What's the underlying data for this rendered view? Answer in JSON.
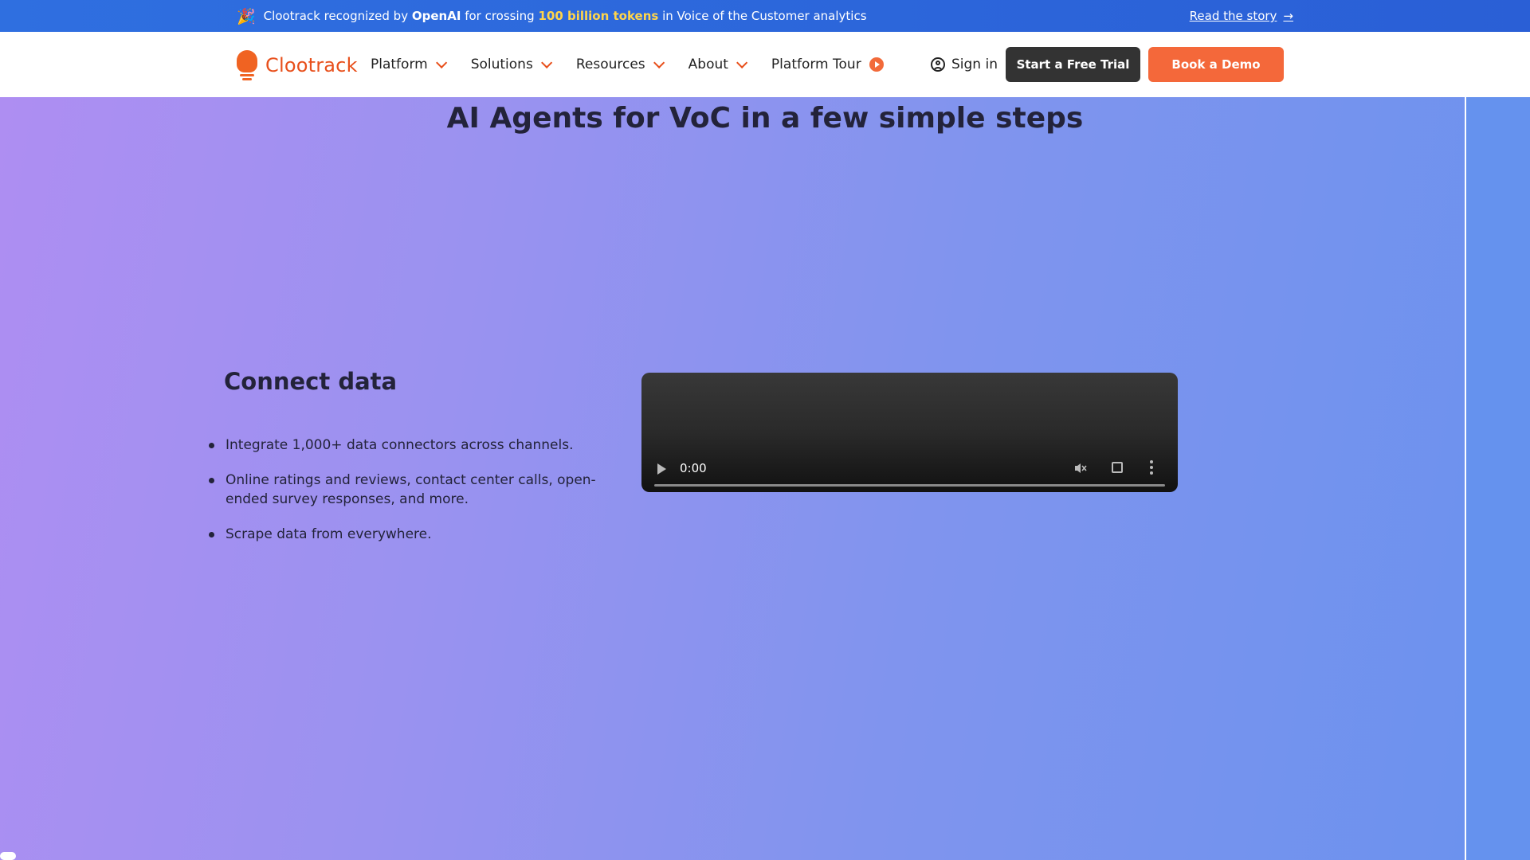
{
  "announcement": {
    "icon": "party-popper-icon",
    "prefix": "Clootrack recognized by",
    "brand": "OpenAI",
    "middle": "for crossing",
    "highlight": "100 billion tokens",
    "suffix": "in Voice of the Customer analytics",
    "link": "Read the story"
  },
  "nav": {
    "logo": "Clootrack",
    "menu": [
      {
        "label": "Platform"
      },
      {
        "label": "Solutions"
      },
      {
        "label": "Resources"
      },
      {
        "label": "About"
      },
      {
        "label": "Platform Tour"
      }
    ],
    "signin": "Sign in",
    "trial_button": "Start a Free Trial",
    "demo_button": "Book a Demo"
  },
  "section": {
    "title": "AI Agents for VoC in a few simple steps",
    "step_title": "Connect data",
    "bullets": [
      "Integrate 1,000+ data connectors across channels.",
      "Online ratings and reviews, contact center calls, open-ended survey responses, and more.",
      "Scrape data from everywhere."
    ],
    "video_time": "0:00"
  },
  "colors": {
    "brand_orange": "#f4683a",
    "announce_blue": "#2f6fe0",
    "dark_button": "#333333"
  }
}
